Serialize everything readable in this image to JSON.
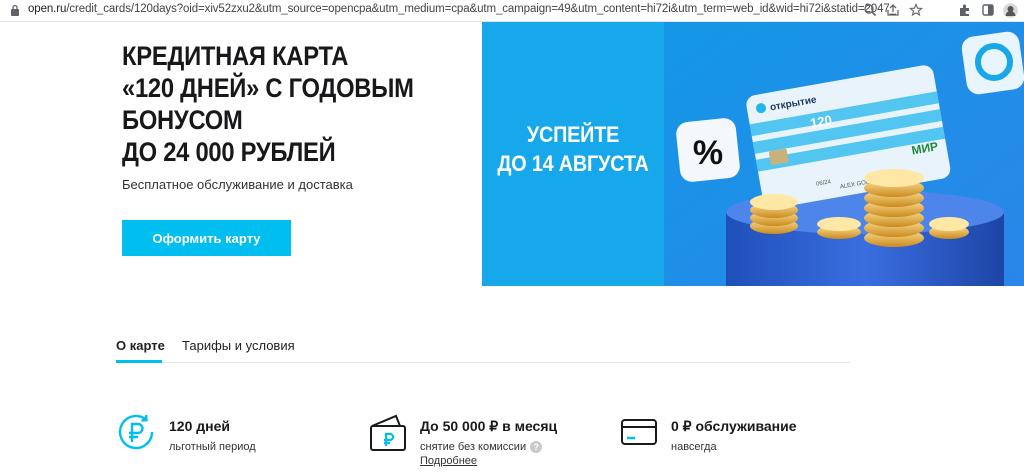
{
  "browser": {
    "url_host": "open.ru",
    "url_rest": "/credit_cards/120days?oid=xiv52zxu2&utm_source=opencpa&utm_medium=cpa&utm_campaign=49&utm_content=hi72i&utm_term=web_id&wid=hi72i&statid=2047_",
    "icons": [
      "lock-icon",
      "google-lens-icon",
      "share-icon",
      "star-icon",
      "extensions-icon",
      "sidebar-icon",
      "avatar"
    ]
  },
  "hero": {
    "title_lines": [
      "КРЕДИТНАЯ КАРТА",
      "«120 ДНЕЙ» С ГОДОВЫМ",
      "БОНУСОМ",
      "ДО 24 000 РУБЛЕЙ"
    ],
    "subtitle": "Бесплатное обслуживание и доставка",
    "cta": "Оформить карту"
  },
  "banner": {
    "text_lines": [
      "УСПЕЙТЕ",
      "ДО 14 АВГУСТА"
    ],
    "badge": "%",
    "card_brand": "открытие",
    "card_number_fragment": "120",
    "card_payment_system": "МИР",
    "card_holder": "ALEX GOLDER",
    "card_exp": "06/24",
    "colors": {
      "left": "#16a8ea",
      "right": "#1ea7eb",
      "accent": "#00beef"
    }
  },
  "tabs": {
    "items": [
      {
        "label": "О карте",
        "active": true
      },
      {
        "label": "Тарифы и условия",
        "active": false
      }
    ]
  },
  "features": [
    {
      "icon": "ruble-clock-icon",
      "title": "120 дней",
      "desc": "льготный период"
    },
    {
      "icon": "wallet-ruble-icon",
      "title": "До 50 000 ₽ в месяц",
      "desc": "снятие без комиссии",
      "help": "?",
      "link": "Подробнее"
    },
    {
      "icon": "credit-card-icon",
      "title": "0 ₽ обслуживание",
      "desc": "навсегда"
    }
  ]
}
